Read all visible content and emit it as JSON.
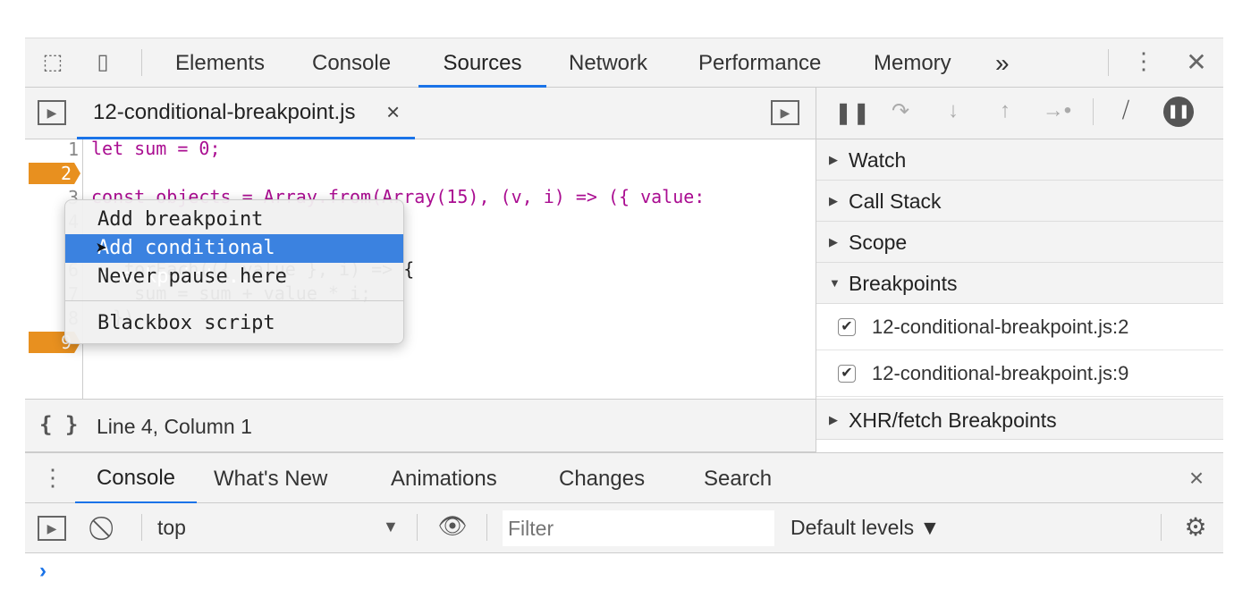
{
  "main_tabs": [
    "Elements",
    "Console",
    "Sources",
    "Network",
    "Performance",
    "Memory"
  ],
  "more_tabs": "»",
  "editor": {
    "file_tab": "12-conditional-breakpoint.js",
    "close": "×",
    "lines": [
      {
        "n": "1",
        "code": "let sum = 0;"
      },
      {
        "n": "2",
        "code": ""
      },
      {
        "n": "3",
        "code": "const objects = Array.from(Array(15), (v, i) => ({ value:"
      },
      {
        "n": "4",
        "code": ""
      },
      {
        "n": "5",
        "code": "objects"
      },
      {
        "n": "6",
        "code": "  .forEach(({ value }, i) => {"
      },
      {
        "n": "7",
        "code": "    sum = sum + value * i;"
      },
      {
        "n": "8",
        "code": "  })"
      },
      {
        "n": "9",
        "code": ""
      }
    ],
    "breakpoint_lines": [
      "2",
      "9"
    ],
    "status": "Line 4, Column 1",
    "format_icon": "{ }"
  },
  "context_menu": {
    "items": [
      "Add breakpoint",
      "Add conditional breakpoint...",
      "Never pause here",
      "Blackbox script"
    ],
    "highlighted": 1
  },
  "debugger": {
    "sections": [
      "Watch",
      "Call Stack",
      "Scope",
      "Breakpoints",
      "XHR/fetch Breakpoints"
    ],
    "breakpoints": [
      {
        "label": "12-conditional-breakpoint.js:2",
        "checked": true
      },
      {
        "label": "12-conditional-breakpoint.js:9",
        "checked": true
      }
    ]
  },
  "drawer": {
    "tabs": [
      "Console",
      "What's New",
      "Animations",
      "Changes",
      "Search"
    ],
    "close": "×",
    "context": "top",
    "filter_placeholder": "Filter",
    "levels": "Default levels ▼",
    "prompt": "›"
  },
  "colors": {
    "accent": "#1a73e8",
    "breakpoint": "#e8901f",
    "highlight": "#3b82e0"
  }
}
